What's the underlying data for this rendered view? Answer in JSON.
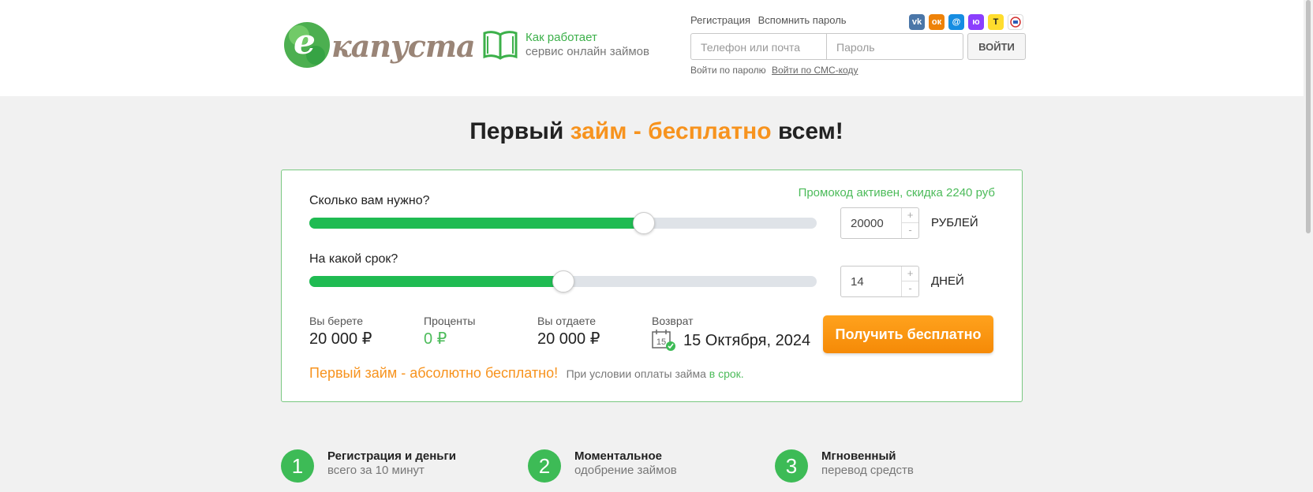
{
  "header": {
    "logo": {
      "letter": "e",
      "name": "капуста"
    },
    "how_it_works": {
      "line1": "Как работает",
      "line2": "сервис онлайн займов"
    },
    "auth": {
      "register": "Регистрация",
      "forgot": "Вспомнить пароль",
      "phone_placeholder": "Телефон или почта",
      "password_placeholder": "Пароль",
      "login": "ВОЙТИ",
      "by_password": "Войти по паролю",
      "by_sms": "Войти по СМС-коду"
    },
    "socials": [
      {
        "name": "vk-icon",
        "label": "vk",
        "color": "#4a76a8"
      },
      {
        "name": "odnoklassniki-icon",
        "label": "ок",
        "color": "#ee8208"
      },
      {
        "name": "mail-icon",
        "label": "@",
        "color": "#168de2"
      },
      {
        "name": "yumoney-icon",
        "label": "ю",
        "color": "#8b3ffd"
      },
      {
        "name": "tinkoff-icon",
        "label": "T",
        "color": "#ffdd2d"
      },
      {
        "name": "gosuslugi-icon",
        "label": "",
        "color": "#ffffff"
      }
    ]
  },
  "hero": {
    "title_part1": "Первый ",
    "title_part2": "займ - бесплатно",
    "title_part3": " всем!"
  },
  "calculator": {
    "promo": "Промокод активен, скидка 2240 руб",
    "amount": {
      "question": "Сколько вам нужно?",
      "value": "20000",
      "unit": "РУБЛЕЙ",
      "fraction": 0.66
    },
    "term": {
      "question": "На какой срок?",
      "value": "14",
      "unit": "ДНЕЙ",
      "fraction": 0.5
    },
    "stepper_plus": "+",
    "stepper_minus": "-",
    "take": {
      "label": "Вы берете",
      "value": "20 000 ₽"
    },
    "interest": {
      "label": "Проценты",
      "value": "0 ₽"
    },
    "give": {
      "label": "Вы отдаете",
      "value": "20 000 ₽"
    },
    "return": {
      "label": "Возврат",
      "date": "15 Октября, 2024",
      "calendar_day": "15"
    },
    "button": "Получить бесплатно",
    "free_big": "Первый займ - абсолютно бесплатно!",
    "free_small": "При условии оплаты займа ",
    "free_link": "в срок."
  },
  "steps": [
    {
      "num": "1",
      "title": "Регистрация и деньги",
      "sub": "всего за 10 минут"
    },
    {
      "num": "2",
      "title": "Моментальное",
      "sub": "одобрение займов"
    },
    {
      "num": "3",
      "title": "Мгновенный",
      "sub": "перевод средств"
    }
  ]
}
